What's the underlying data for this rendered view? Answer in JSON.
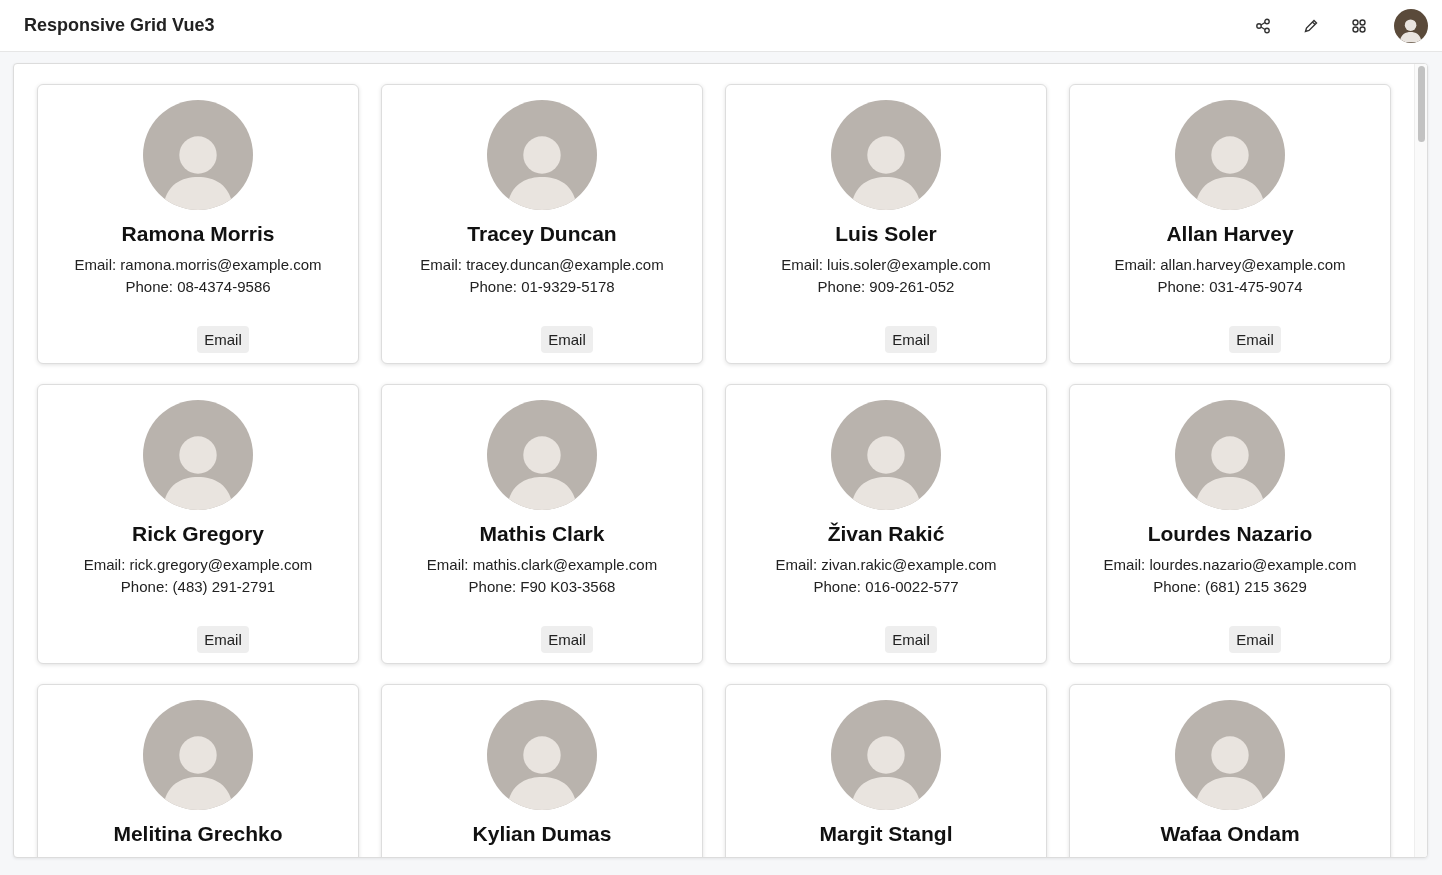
{
  "header": {
    "title": "Responsive Grid Vue3"
  },
  "contacts": [
    {
      "name": "Ramona Morris",
      "email": "Email: ramona.morris@example.com",
      "phone": "Phone: 08-4374-9586",
      "button": "Email"
    },
    {
      "name": "Tracey Duncan",
      "email": "Email: tracey.duncan@example.com",
      "phone": "Phone: 01-9329-5178",
      "button": "Email"
    },
    {
      "name": "Luis Soler",
      "email": "Email: luis.soler@example.com",
      "phone": "Phone: 909-261-052",
      "button": "Email"
    },
    {
      "name": "Allan Harvey",
      "email": "Email: allan.harvey@example.com",
      "phone": "Phone: 031-475-9074",
      "button": "Email"
    },
    {
      "name": "Rick Gregory",
      "email": "Email: rick.gregory@example.com",
      "phone": "Phone: (483) 291-2791",
      "button": "Email"
    },
    {
      "name": "Mathis Clark",
      "email": "Email: mathis.clark@example.com",
      "phone": "Phone: F90 K03-3568",
      "button": "Email"
    },
    {
      "name": "Živan Rakić",
      "email": "Email: zivan.rakic@example.com",
      "phone": "Phone: 016-0022-577",
      "button": "Email"
    },
    {
      "name": "Lourdes Nazario",
      "email": "Email: lourdes.nazario@example.com",
      "phone": "Phone: (681) 215 3629",
      "button": "Email"
    },
    {
      "name": "Melitina Grechko"
    },
    {
      "name": "Kylian Dumas"
    },
    {
      "name": "Margit Stangl"
    },
    {
      "name": "Wafaa Ondam"
    }
  ]
}
